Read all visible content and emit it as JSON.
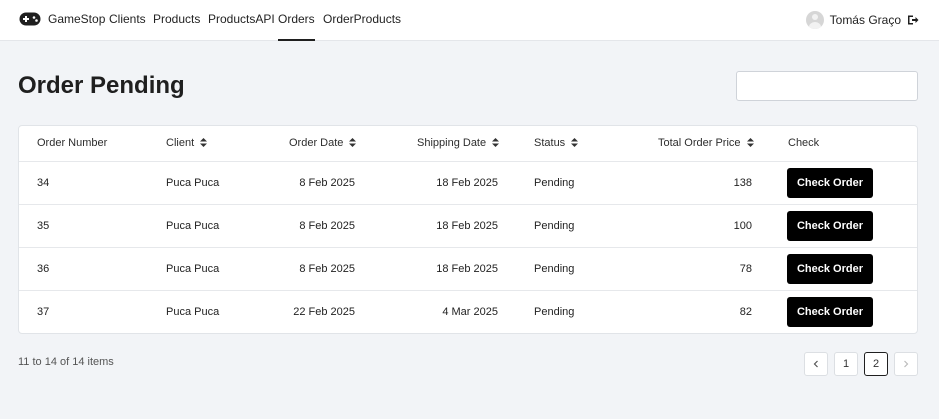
{
  "nav": {
    "brand": "GameStop",
    "links": [
      "Clients",
      "Products",
      "ProductsAPI",
      "Orders",
      "OrderProducts"
    ],
    "active": "Orders",
    "user_name": "Tomás Graço"
  },
  "page": {
    "title": "Order Pending",
    "search_value": ""
  },
  "table": {
    "columns": {
      "order_number": "Order Number",
      "client": "Client",
      "order_date": "Order Date",
      "shipping_date": "Shipping Date",
      "status": "Status",
      "total": "Total Order Price",
      "check": "Check"
    },
    "rows": [
      {
        "order_number": "34",
        "client": "Puca Puca",
        "order_date": "8 Feb 2025",
        "shipping_date": "18 Feb 2025",
        "status": "Pending",
        "total": "138",
        "action": "Check Order"
      },
      {
        "order_number": "35",
        "client": "Puca Puca",
        "order_date": "8 Feb 2025",
        "shipping_date": "18 Feb 2025",
        "status": "Pending",
        "total": "100",
        "action": "Check Order"
      },
      {
        "order_number": "36",
        "client": "Puca Puca",
        "order_date": "8 Feb 2025",
        "shipping_date": "18 Feb 2025",
        "status": "Pending",
        "total": "78",
        "action": "Check Order"
      },
      {
        "order_number": "37",
        "client": "Puca Puca",
        "order_date": "22 Feb 2025",
        "shipping_date": "4 Mar 2025",
        "status": "Pending",
        "total": "82",
        "action": "Check Order"
      }
    ]
  },
  "pagination": {
    "info": "11 to 14 of 14 items",
    "pages": [
      "1",
      "2"
    ],
    "current_page": "2"
  },
  "icons": {
    "logo": "gamepad-icon",
    "sort": "sort-icon",
    "logout": "logout-icon",
    "prev": "chevron-left-icon",
    "next": "chevron-right-icon"
  },
  "colors": {
    "primary_button": "#000000",
    "background": "#f2f4f7"
  }
}
